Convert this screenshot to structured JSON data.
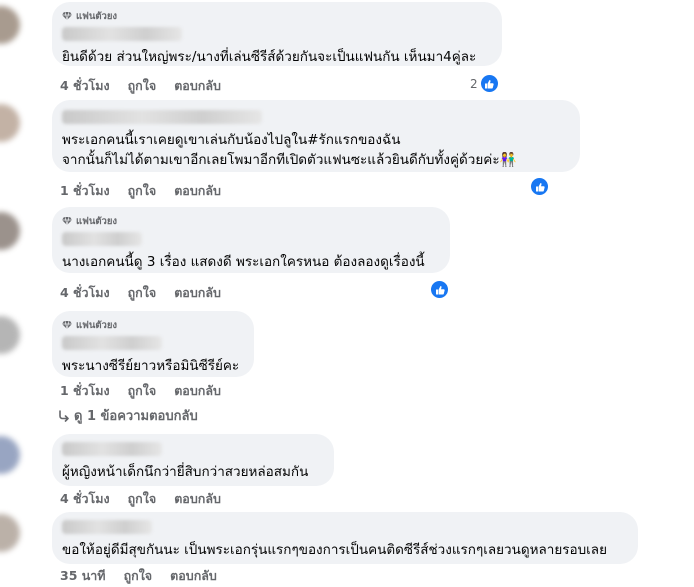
{
  "badge_label": "แฟนตัวยง",
  "actions": {
    "like": "ถูกใจ",
    "reply": "ตอบกลับ"
  },
  "colors": {
    "bubble": "#f0f2f5",
    "secondary_text": "#65676b",
    "like_blue": "#1877f2"
  },
  "icons": {
    "badge": "diamond-icon",
    "reaction": "thumbs-up-icon",
    "replies": "reply-arrow-icon"
  },
  "comments": [
    {
      "line1": "ยินดีด้วย ส่วนใหญ่พระ/นางที่เล่นซีรีส์ด้วยกันจะเป็นแฟนกัน เห็นมา4คู่ละ",
      "line2": "",
      "time": "4 ชั่วโมง",
      "reaction_count": "2"
    },
    {
      "line1": "พระเอกคนนี้เราเคยดูเขาเล่นกับน้องไปลูใน#รักแรกของฉัน",
      "line2": "จากนั้นก็ไม่ได้ตามเขาอีกเลยโพมาอีกทีเปิดตัวแฟนซะแล้วยินดีกับทั้งคู่ด้วยค่ะ👫",
      "time": "1 ชั่วโมง",
      "reaction_count": ""
    },
    {
      "line1": "นางเอกคนนี้ดู 3 เรื่อง แสดงดี พระเอกใครหนอ ต้องลองดูเรื่องนี้",
      "line2": "",
      "time": "4 ชั่วโมง",
      "reaction_count": ""
    },
    {
      "line1": "พระนางซีรีย์ยาวหรือมินิซีรีย์คะ",
      "line2": "",
      "time": "1 ชั่วโมง",
      "reaction_count": ""
    },
    {
      "line1": "ผู้หญิงหน้าเด็กนึกว่ายี่สิบกว่าสวยหล่อสมกัน",
      "line2": "",
      "time": "4 ชั่วโมง",
      "reaction_count": ""
    },
    {
      "line1": "ขอให้อยู่ดีมีสุขกันนะ เป็นพระเอกรุ่นแรกๆของการเป็นคนติดซีรีส์ช่วงแรกๆเลยวนดูหลายรอบเลย",
      "line2": "",
      "time": "35 นาที",
      "reaction_count": ""
    }
  ],
  "replies_link": "ดู 1 ข้อความตอบกลับ"
}
